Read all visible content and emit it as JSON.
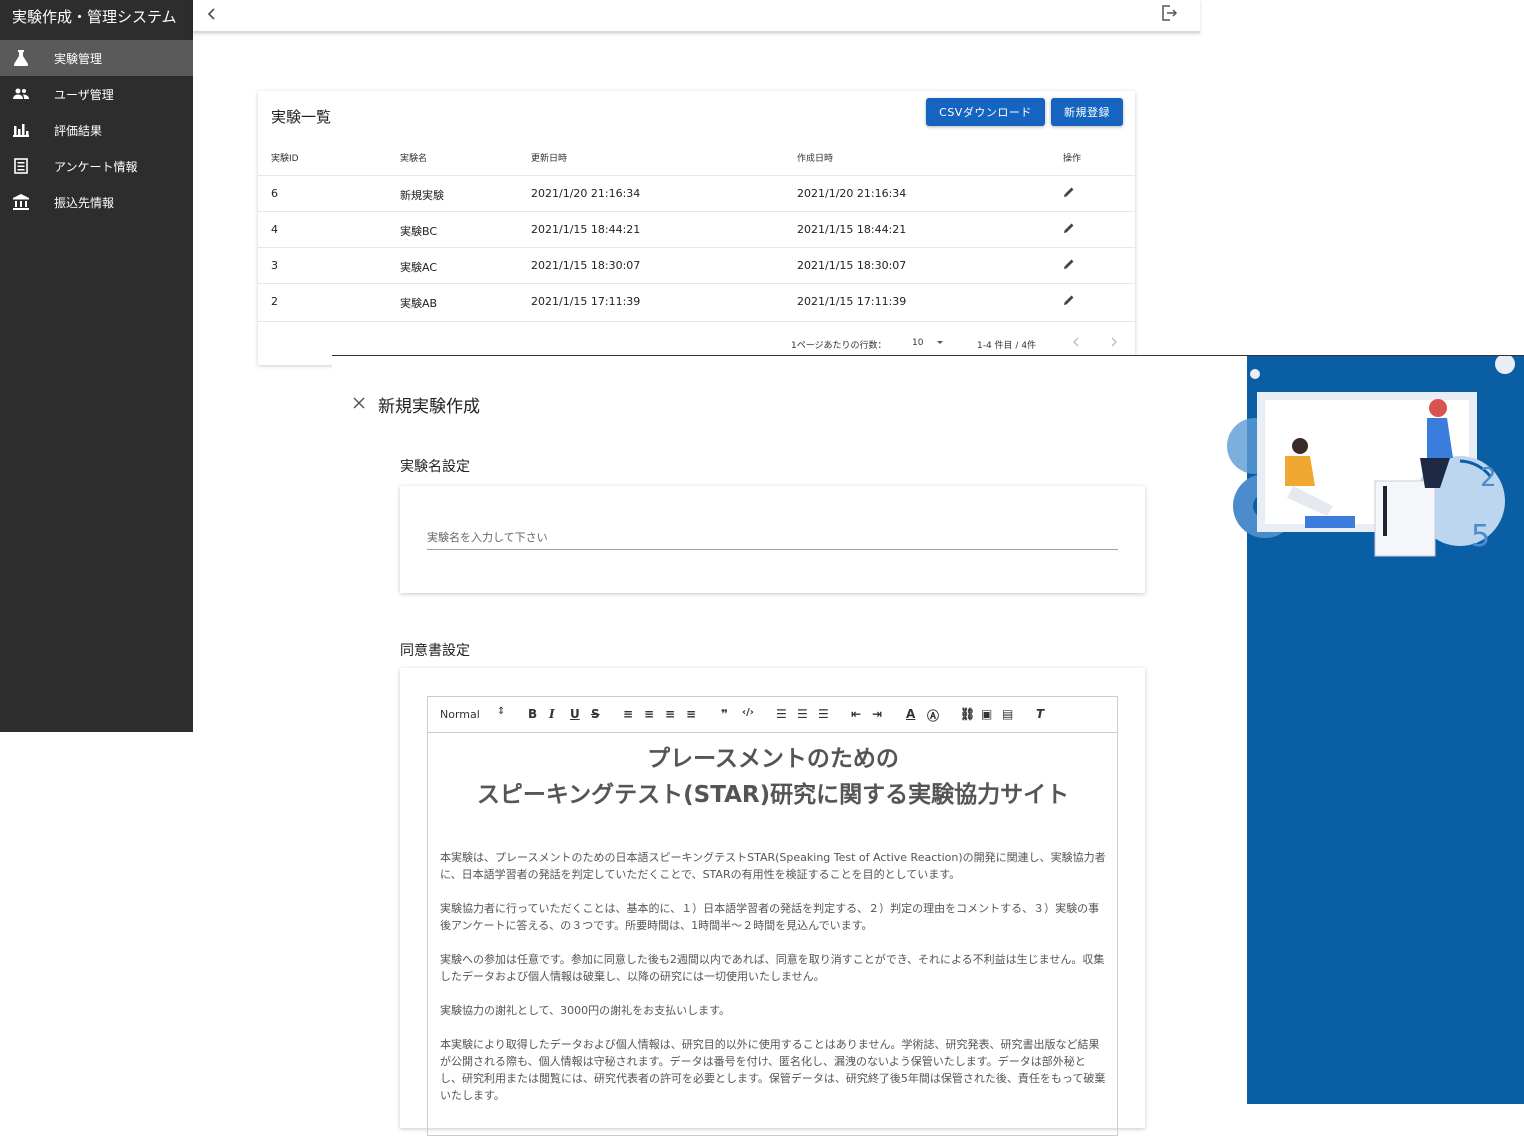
{
  "app": {
    "title": "実験作成・管理システム"
  },
  "sidebar": {
    "items": [
      {
        "label": "実験管理",
        "icon": "flask-icon",
        "active": true
      },
      {
        "label": "ユーザ管理",
        "icon": "users-icon",
        "active": false
      },
      {
        "label": "評価結果",
        "icon": "bar-chart-icon",
        "active": false
      },
      {
        "label": "アンケート情報",
        "icon": "document-icon",
        "active": false
      },
      {
        "label": "振込先情報",
        "icon": "bank-icon",
        "active": false
      }
    ]
  },
  "topbar": {
    "back_icon": "chevron-left-icon",
    "logout_icon": "logout-icon"
  },
  "experiment_list": {
    "title": "実験一覧",
    "csv_button": "CSVダウンロード",
    "new_button": "新規登録",
    "columns": [
      "実験ID",
      "実験名",
      "更新日時",
      "作成日時",
      "操作"
    ],
    "rows": [
      {
        "id": "6",
        "name": "新規実験",
        "updated": "2021/1/20 21:16:34",
        "created": "2021/1/20 21:16:34"
      },
      {
        "id": "4",
        "name": "実験BC",
        "updated": "2021/1/15 18:44:21",
        "created": "2021/1/15 18:44:21"
      },
      {
        "id": "3",
        "name": "実験AC",
        "updated": "2021/1/15 18:30:07",
        "created": "2021/1/15 18:30:07"
      },
      {
        "id": "2",
        "name": "実験AB",
        "updated": "2021/1/15 17:11:39",
        "created": "2021/1/15 17:11:39"
      }
    ],
    "pager": {
      "rows_per_page_label": "1ページあたりの行数：",
      "rows_per_page": "10",
      "range": "1-4 件目 / 4件"
    }
  },
  "new_experiment": {
    "title": "新規実験作成",
    "name_section_label": "実験名設定",
    "name_placeholder": "実験名を入力して下さい",
    "consent_section_label": "同意書設定",
    "editor": {
      "format": "Normal",
      "heading_line1": "プレースメントのための",
      "heading_line2": "スピーキングテスト(STAR)研究に関する実験協力サイト",
      "paragraphs": [
        "本実験は、プレースメントのための日本語スピーキングテストSTAR(Speaking Test of Active Reaction)の開発に関連し、実験協力者に、日本語学習者の発話を判定していただくことで、STARの有用性を検証することを目的としています。",
        "実験協力者に行っていただくことは、基本的に、１）日本語学習者の発話を判定する、２）判定の理由をコメントする、３）実験の事後アンケートに答える、の３つです。所要時間は、1時間半～２時間を見込んでいます。",
        "実験への参加は任意です。参加に同意した後も2週間以内であれば、同意を取り消すことができ、それによる不利益は生じません。収集したデータおよび個人情報は破棄し、以降の研究には一切使用いたしません。",
        "実験協力の謝礼として、3000円の謝礼をお支払いします。",
        "本実験により取得したデータおよび個人情報は、研究目的以外に使用することはありません。学術誌、研究発表、研究書出版など結果が公開される際も、個人情報は守秘されます。データは番号を付け、匿名化し、漏洩のないよう保管いたします。データは部外秘とし、研究利用または閲覧には、研究代表者の許可を必要とします。保管データは、研究終了後5年間は保管された後、責任をもって破棄いたします。"
      ]
    }
  },
  "colors": {
    "sidebar": "#2d2d2d",
    "accent": "#1565c0",
    "blue_panel": "#0a5ea3"
  }
}
